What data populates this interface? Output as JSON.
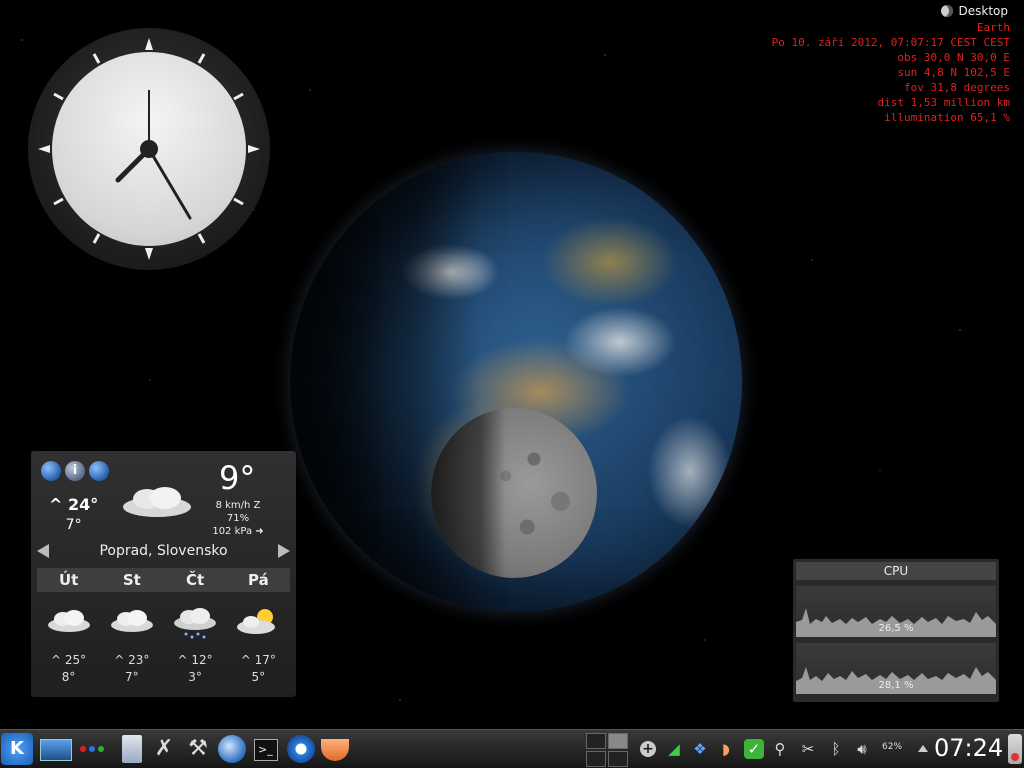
{
  "desktop": {
    "label": "Desktop"
  },
  "astro": {
    "lines": [
      "Earth",
      "Po 10. září 2012, 07:07:17 CEST CEST",
      "obs 30,0 N  30,0 E",
      "sun  4,8 N 102,5 E",
      "fov 31,8 degrees",
      "dist 1,53 million km",
      "illumination 65,1 %"
    ]
  },
  "weather": {
    "current_temp": "9°",
    "high": "^ 24°",
    "low": "7°",
    "wind": "8 km/h Z",
    "humidity": "71%",
    "pressure": "102 kPa ➜",
    "location": "Poprad, Slovensko",
    "days": [
      "Út",
      "St",
      "Čt",
      "Pá"
    ],
    "forecast": [
      {
        "high": "^ 25°",
        "low": "8°",
        "icon": "cloudy-icon"
      },
      {
        "high": "^ 23°",
        "low": "7°",
        "icon": "cloudy-icon"
      },
      {
        "high": "^ 12°",
        "low": "3°",
        "icon": "rain-icon"
      },
      {
        "high": "^ 17°",
        "low": "5°",
        "icon": "partly-sunny-icon"
      }
    ]
  },
  "cpu": {
    "title": "CPU",
    "cores": [
      {
        "value": "26,5 %"
      },
      {
        "value": "28,1 %"
      }
    ]
  },
  "taskbar": {
    "battery": "62%",
    "time": "07:24",
    "terminal_glyph": ">_",
    "dot_colors": [
      "#e02020",
      "#3070e0",
      "#30b030"
    ]
  }
}
